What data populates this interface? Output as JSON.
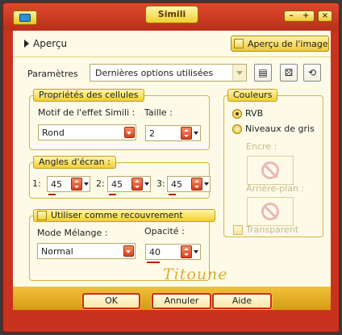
{
  "window": {
    "title": "Simili"
  },
  "preview": {
    "label": "Aperçu",
    "image_toggle_label": "Aperçu de l'image"
  },
  "params": {
    "label": "Paramètres",
    "preset_value": "Dernières options utilisées"
  },
  "cell_props": {
    "title": "Propriétés des cellules",
    "pattern_label": "Motif de l'effet Simili :",
    "pattern_value": "Rond",
    "size_label": "Taille :",
    "size_value": "2"
  },
  "screen_angles": {
    "title": "Angles d'écran :",
    "items": [
      {
        "label": "1:",
        "value": "45"
      },
      {
        "label": "2:",
        "value": "45"
      },
      {
        "label": "3:",
        "value": "45"
      }
    ]
  },
  "overlay": {
    "title": "Utiliser comme recouvrement",
    "blend_label": "Mode Mélange :",
    "blend_value": "Normal",
    "opacity_label": "Opacité :",
    "opacity_value": "40"
  },
  "colors": {
    "title": "Couleurs",
    "rgb_label": "RVB",
    "gray_label": "Niveaux de gris",
    "ink_label": "Encre :",
    "background_label": "Arrière-plan :",
    "transparent_label": "Transparent"
  },
  "signature": "Titoune",
  "buttons": {
    "ok": "OK",
    "cancel": "Annuler",
    "help": "Aide"
  },
  "theme": {
    "frame": "#c8321e",
    "accent": "#f2ce36",
    "client": "#fdfbe8"
  }
}
